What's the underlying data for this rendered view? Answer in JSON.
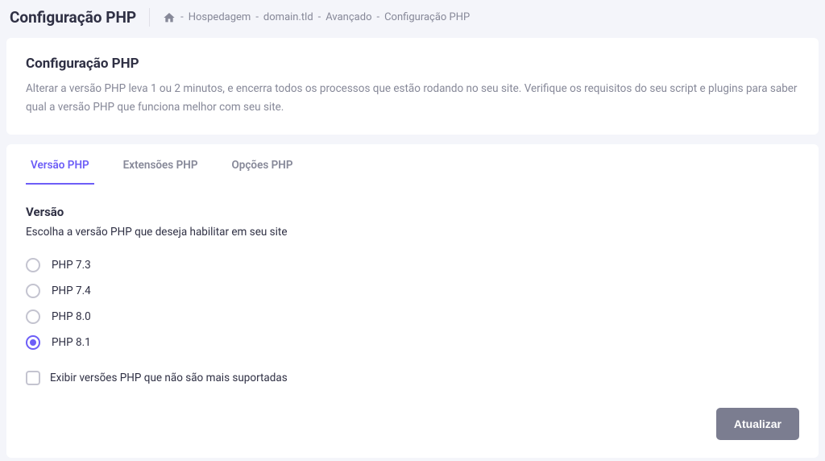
{
  "header": {
    "title": "Configuração PHP",
    "breadcrumbs": {
      "items": [
        "Hospedagem",
        "domain.tld",
        "Avançado",
        "Configuração PHP"
      ]
    }
  },
  "intro_card": {
    "title": "Configuração PHP",
    "description": "Alterar a versão PHP leva 1 ou 2 minutos, e encerra todos os processos que estão rodando no seu site. Verifique os requisitos do seu script e plugins para saber qual a versão PHP que funciona melhor com seu site."
  },
  "tabs": [
    {
      "label": "Versão PHP",
      "active": true
    },
    {
      "label": "Extensões PHP",
      "active": false
    },
    {
      "label": "Opções PHP",
      "active": false
    }
  ],
  "version_section": {
    "title": "Versão",
    "description": "Escolha a versão PHP que deseja habilitar em seu site",
    "options": [
      {
        "label": "PHP 7.3",
        "selected": false
      },
      {
        "label": "PHP 7.4",
        "selected": false
      },
      {
        "label": "PHP 8.0",
        "selected": false
      },
      {
        "label": "PHP 8.1",
        "selected": true
      }
    ],
    "show_unsupported_checkbox": {
      "label": "Exibir versões PHP que não são mais suportadas",
      "checked": false
    }
  },
  "actions": {
    "update_label": "Atualizar"
  }
}
